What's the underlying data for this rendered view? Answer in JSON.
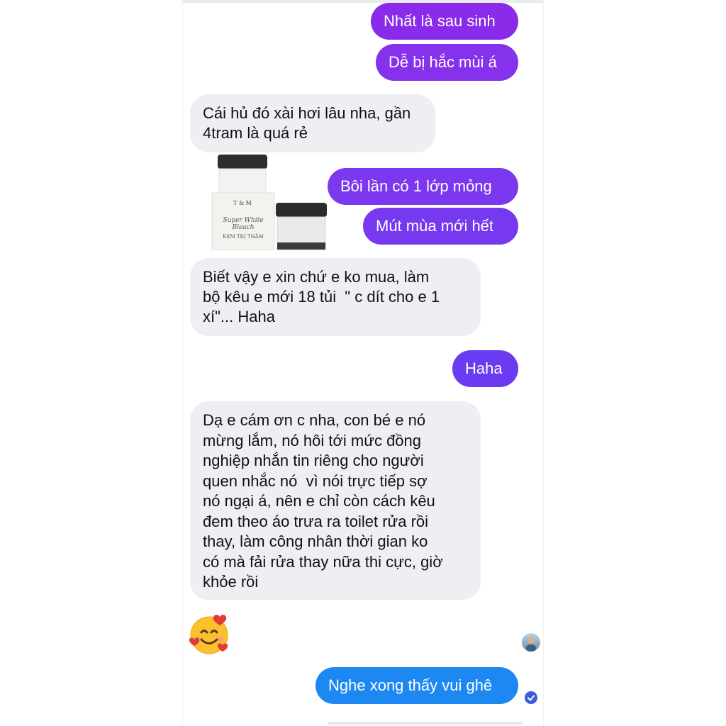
{
  "messages": [
    {
      "text": "Nhất là sau sinh"
    },
    {
      "text": "Dễ bị hắc mùi á"
    },
    {
      "text": "Cái hủ đó xài hơi lâu nha, gần\n4tram là quá rẻ"
    },
    {
      "text": "Bôi lần có 1 lớp mỏng"
    },
    {
      "text": "Mút mùa mới hết"
    },
    {
      "text": "Biết vậy e xin chứ e ko mua, làm\nbộ kêu e mới 18 tủi  \" c dít cho e 1\nxí\"... Haha"
    },
    {
      "text": "Haha"
    },
    {
      "text": "Dạ e cám ơn c nha, con bé e nó\nmừng lắm, nó hôi tới mức đồng\nnghiệp nhắn tin riêng cho người\nquen nhắc nó  vì nói trực tiếp sợ\nnó ngại á, nên e chỉ còn cách kêu\nđem theo áo trưa ra toilet rửa rồi\nthay, làm công nhân thời gian ko\ncó mà fải rửa thay nữa thi cực, giờ\nkhỏe rồi"
    },
    {
      "text": "Nghe xong thấy vui ghê"
    }
  ],
  "product": {
    "brand": "T & M",
    "line1": "Super White Bleach",
    "line2": "KEM TRỊ THÂM"
  },
  "colors": {
    "outgoing_purple": "#8a2bea",
    "outgoing_violet": "#6a3bf0",
    "outgoing_blue": "#1e88f2",
    "incoming": "#efeff3"
  },
  "icons": {
    "reaction": "smiling-face-with-hearts-emoji",
    "seen": "seen-check-icon",
    "avatar": "contact-avatar"
  }
}
